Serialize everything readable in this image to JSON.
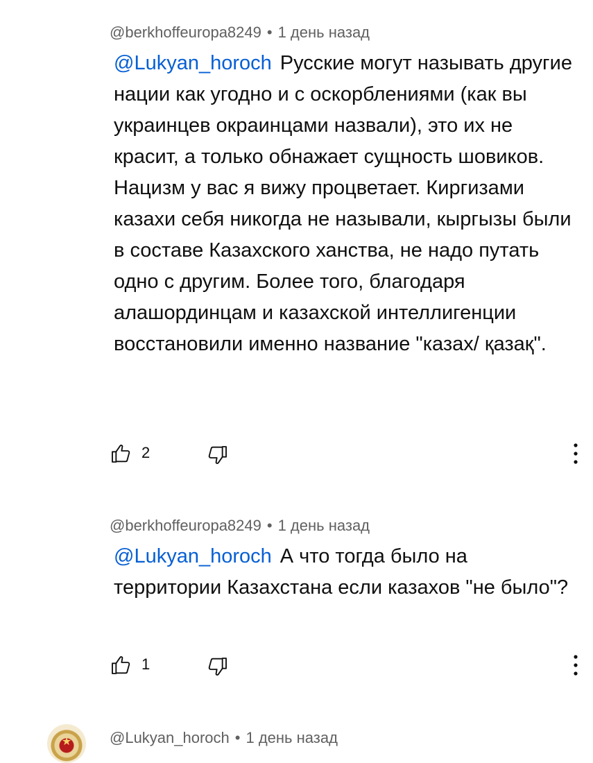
{
  "comments": [
    {
      "author": "@berkhoffeuropa8249",
      "separator": "•",
      "time": "1 день назад",
      "mention": "@Lukyan_horoch",
      "text": "Русские могут называть другие нации как угодно и с оскорблениями (как вы украинцев окраинцами назвали), это их не красит, а только обнажает сущность шовиков. Нацизм у вас я вижу процветает. Киргизами казахи себя никогда не называли, кыргызы были в составе Казахского ханства, не надо путать одно с другим. Более того, благодаря алашординцам и казахской интеллигенции восстановили именно название \"казах/ қазақ\".",
      "likes": "2"
    },
    {
      "author": "@berkhoffeuropa8249",
      "separator": "•",
      "time": "1 день назад",
      "mention": "@Lukyan_horoch",
      "text": "А что тогда было на территории Казахстана если казахов \"не было\"?",
      "likes": "1"
    },
    {
      "author": "@Lukyan_horoch",
      "separator": "•",
      "time": "1 день назад"
    }
  ],
  "icons": {
    "like": "thumb-up-icon",
    "dislike": "thumb-down-icon",
    "more": "more-vert-icon"
  },
  "colors": {
    "mention": "#065fd4",
    "meta": "#606060",
    "text": "#0f0f0f"
  }
}
